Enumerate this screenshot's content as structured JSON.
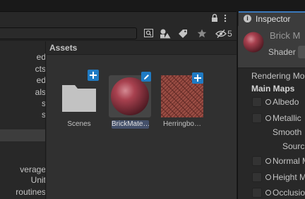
{
  "project": {
    "hidden_packages_count": "5",
    "tree_items": [
      "ed",
      "cts",
      "ed",
      "als",
      "s",
      "s",
      "",
      "",
      "",
      "",
      "verage",
      "Unit",
      "routines"
    ],
    "breadcrumb": "Assets",
    "assets": [
      {
        "label": "Scenes",
        "type": "folder",
        "badge": "add"
      },
      {
        "label": "BrickMate…",
        "type": "material",
        "badge": "edit"
      },
      {
        "label": "Herringbo…",
        "type": "texture",
        "badge": "add"
      }
    ]
  },
  "inspector": {
    "tab_label": "Inspector",
    "material_name": "Brick M",
    "shader_label": "Shader",
    "rendering_mode": "Rendering Mo",
    "main_maps": "Main Maps",
    "maps": {
      "albedo": "Albedo",
      "metallic": "Metallic",
      "smoothness": "Smooth",
      "source": "Sourc",
      "normal": "Normal M",
      "height": "Height M",
      "occlusion": "Occlusio"
    }
  },
  "colors": {
    "accent": "#3a79bb",
    "badge": "#1f7bc4",
    "selection": "#44506a",
    "material": "#a8414f",
    "brick": "#8a4038"
  }
}
